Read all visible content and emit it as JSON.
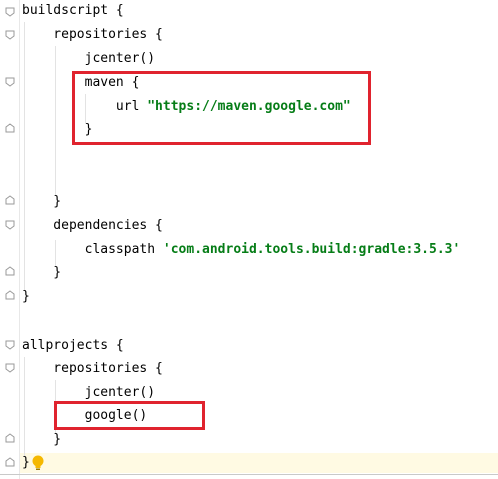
{
  "editor": {
    "lines": [
      {
        "text": "buildscript {"
      },
      {
        "text": "    repositories {"
      },
      {
        "text": "        jcenter()"
      },
      {
        "text": "        maven {"
      },
      {
        "text": "            url "
      },
      {
        "text": "\"https://maven.google.com\""
      },
      {
        "text": "        }"
      },
      {
        "text": "    }"
      },
      {
        "text": "    dependencies {"
      },
      {
        "text": "        classpath "
      },
      {
        "text": "'com.android.tools.build:gradle:3.5.3'"
      },
      {
        "text": "    }"
      },
      {
        "text": "}"
      },
      {
        "text": "allprojects {"
      },
      {
        "text": "    repositories {"
      },
      {
        "text": "        jcenter()"
      },
      {
        "text": "        google()"
      },
      {
        "text": "    }"
      },
      {
        "text": "}"
      }
    ]
  },
  "colors": {
    "highlight_box": "#e0232e",
    "string": "#067d17",
    "bulb": "#f5b800"
  },
  "icons": {
    "fold": "fold-marker-icon",
    "bulb": "lightbulb-icon"
  }
}
